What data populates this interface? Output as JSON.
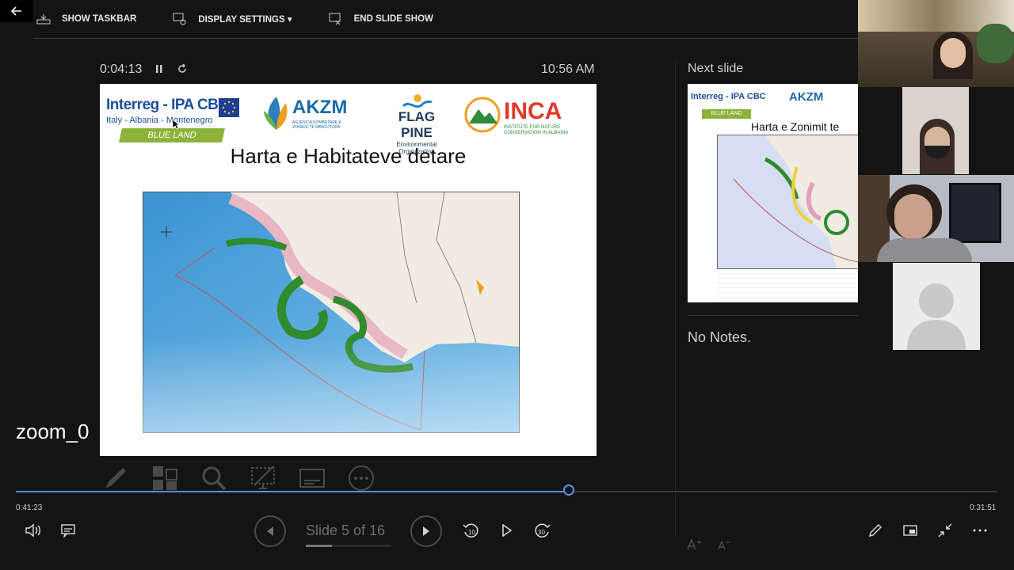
{
  "toolbar": {
    "show_taskbar": "SHOW TASKBAR",
    "display_settings": "DISPLAY SETTINGS ▾",
    "end_slide_show": "END SLIDE SHOW"
  },
  "presenter": {
    "timer": "0:04:13",
    "clock": "10:56 AM",
    "next_label": "Next slide",
    "notes": "No Notes."
  },
  "current_slide": {
    "title": "Harta e Habitateve detare",
    "logos": {
      "interreg_name": "Interreg - IPA CBC",
      "interreg_sub": "Italy - Albania - Montenegro",
      "interreg_band": "BLUE LAND",
      "akzm_name": "AKZM",
      "akzm_sub": "AGJENCIA KOMBËTARE E ZONAVE TË MBROJTURA",
      "flag_name": "FLAG PINE",
      "flag_sub": "Environmental Organization",
      "inca_name": "INCA",
      "inca_sub": "INSTITUTE FOR NATURE CONSERVATION IN ALBANIA"
    }
  },
  "next_slide": {
    "title": "Harta e Zonimit te",
    "interreg_name": "Interreg - IPA CBC",
    "interreg_band": "BLUE LAND",
    "akzm_name": "AKZM"
  },
  "participant": {
    "zoom_label": "zoom_0"
  },
  "playback": {
    "elapsed": "0:41:23",
    "remaining": "0:31:51",
    "progress": 0.565
  },
  "navigation": {
    "slide_counter": "Slide 5 of 16",
    "rewind_label": "10",
    "forward_label": "30"
  },
  "colors": {
    "accent": "#5b8ee6",
    "background": "#141414"
  }
}
